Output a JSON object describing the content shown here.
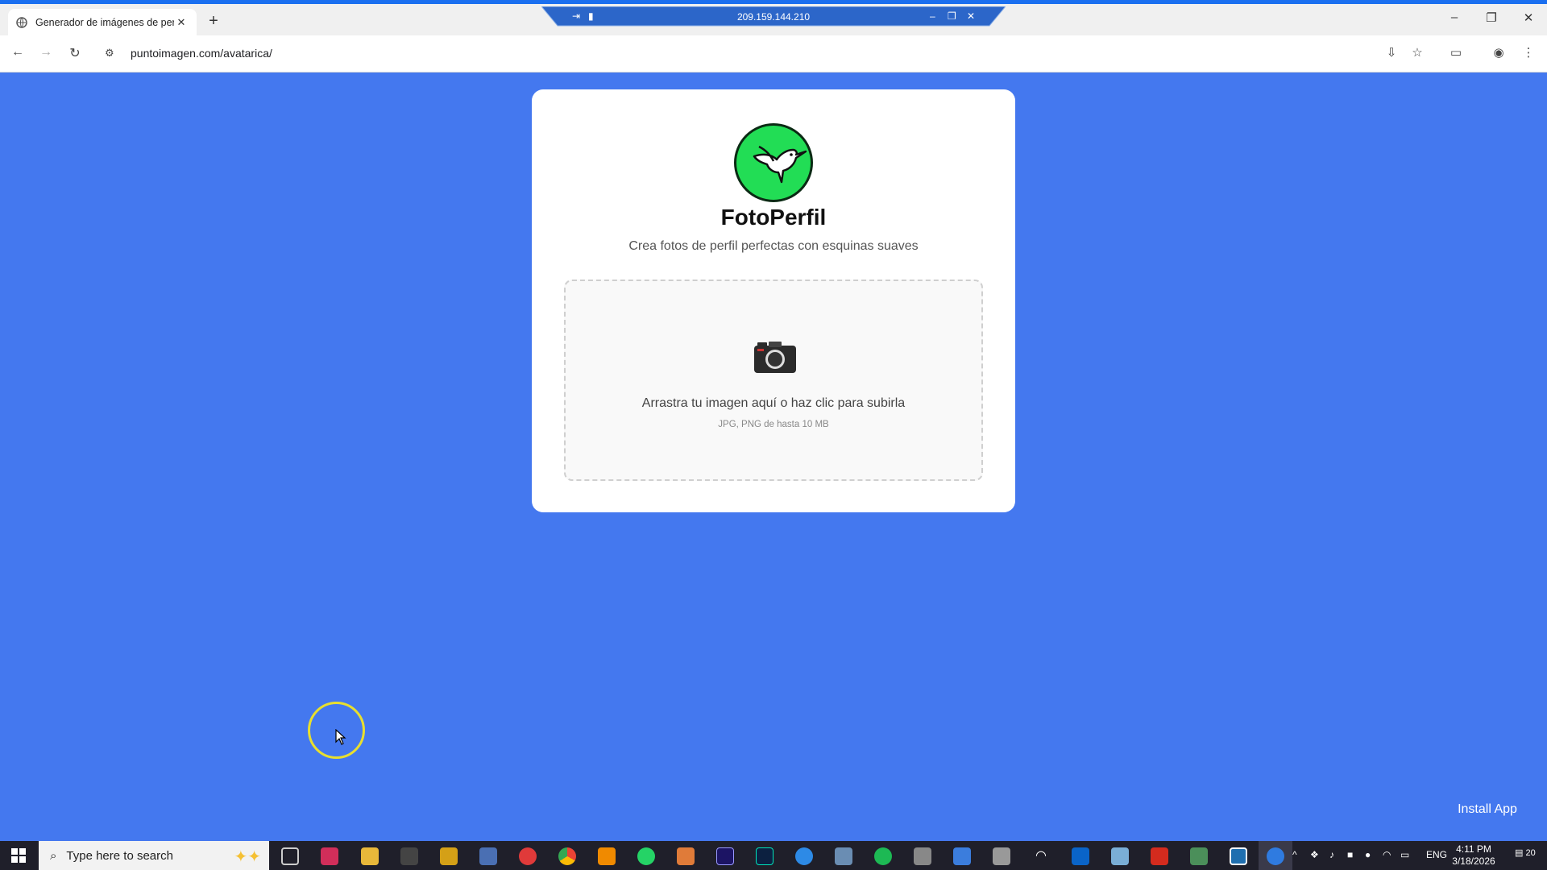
{
  "browser": {
    "tab_title": "Generador de imágenes de per",
    "tab_close": "✕",
    "new_tab": "+",
    "url": "puntoimagen.com/avatarica/"
  },
  "rdp": {
    "ip": "209.159.144.210"
  },
  "app": {
    "title": "FotoPerfil",
    "subtitle": "Crea fotos de perfil perfectas con esquinas suaves",
    "drop_text": "Arrastra tu imagen aquí o haz clic para subirla",
    "drop_hint": "JPG, PNG de hasta 10 MB",
    "install_label": "Install App"
  },
  "taskbar": {
    "search_placeholder": "Type here to search",
    "lang": "ENG",
    "time": "4:11 PM",
    "date": "3/18/2026",
    "notifications": "20"
  },
  "colors": {
    "page_bg": "#4478ef",
    "logo_green": "#22dd55",
    "taskbar": "#1f1f2a"
  }
}
